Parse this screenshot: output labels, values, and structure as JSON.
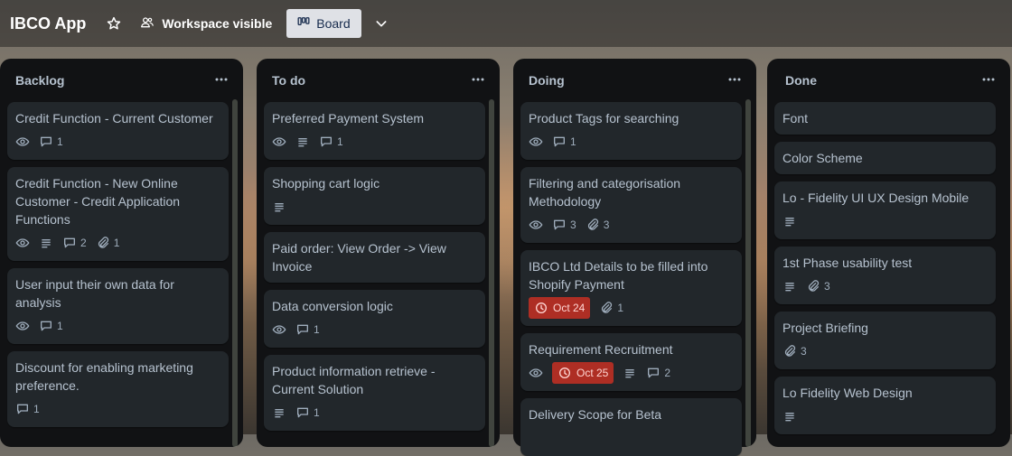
{
  "header": {
    "app_title": "IBCO App",
    "visibility_label": "Workspace visible",
    "view_label": "Board"
  },
  "lists": [
    {
      "title": "Backlog",
      "cards": [
        {
          "title": "Credit Function - Current Customer",
          "watch": true,
          "description": false,
          "comments": "1",
          "attachments": null
        },
        {
          "title": "Credit Function - New Online Customer - Credit Application Functions",
          "watch": true,
          "description": true,
          "comments": "2",
          "attachments": "1"
        },
        {
          "title": "User input their own data for analysis",
          "watch": true,
          "description": false,
          "comments": "1",
          "attachments": null
        },
        {
          "title": "Discount for enabling marketing preference.",
          "watch": false,
          "description": false,
          "comments": "1",
          "attachments": null
        }
      ]
    },
    {
      "title": "To do",
      "cards": [
        {
          "title": "Preferred Payment System",
          "watch": true,
          "description": true,
          "comments": "1",
          "attachments": null
        },
        {
          "title": "Shopping cart logic",
          "watch": false,
          "description": true,
          "comments": null,
          "attachments": null
        },
        {
          "title": "Paid order: View Order -> View Invoice",
          "watch": false,
          "description": false,
          "comments": null,
          "attachments": null
        },
        {
          "title": "Data conversion logic",
          "watch": true,
          "description": false,
          "comments": "1",
          "attachments": null
        },
        {
          "title": "Product information retrieve - Current Solution",
          "watch": false,
          "description": true,
          "comments": "1",
          "attachments": null
        }
      ]
    },
    {
      "title": "Doing",
      "cards": [
        {
          "title": "Product Tags for searching",
          "watch": true,
          "description": false,
          "comments": "1",
          "attachments": null
        },
        {
          "title": "Filtering and categorisation Methodology",
          "watch": true,
          "description": false,
          "comments": "3",
          "attachments": "3"
        },
        {
          "title": "IBCO Ltd Details to be filled into Shopify Payment",
          "due": "Oct 24",
          "attachments": "1"
        },
        {
          "title": "Requirement Recruitment",
          "watch": true,
          "due": "Oct 25",
          "description": true,
          "comments": "2"
        },
        {
          "title": "Delivery Scope for Beta"
        }
      ]
    },
    {
      "title": "Done",
      "cards": [
        {
          "title": "Font"
        },
        {
          "title": "Color Scheme"
        },
        {
          "title": "Lo - Fidelity UI UX Design Mobile",
          "description": true
        },
        {
          "title": "1st Phase usability test",
          "description": true,
          "attachments": "3"
        },
        {
          "title": "Project Briefing",
          "attachments": "3"
        },
        {
          "title": "Lo Fidelity Web Design",
          "description": true
        }
      ]
    }
  ],
  "colors": {
    "list_bg": "#111214",
    "card_bg": "#22272b",
    "text": "#b6c2cf",
    "badge_text": "#9fadbc",
    "overdue_bg": "#ae2e24"
  }
}
